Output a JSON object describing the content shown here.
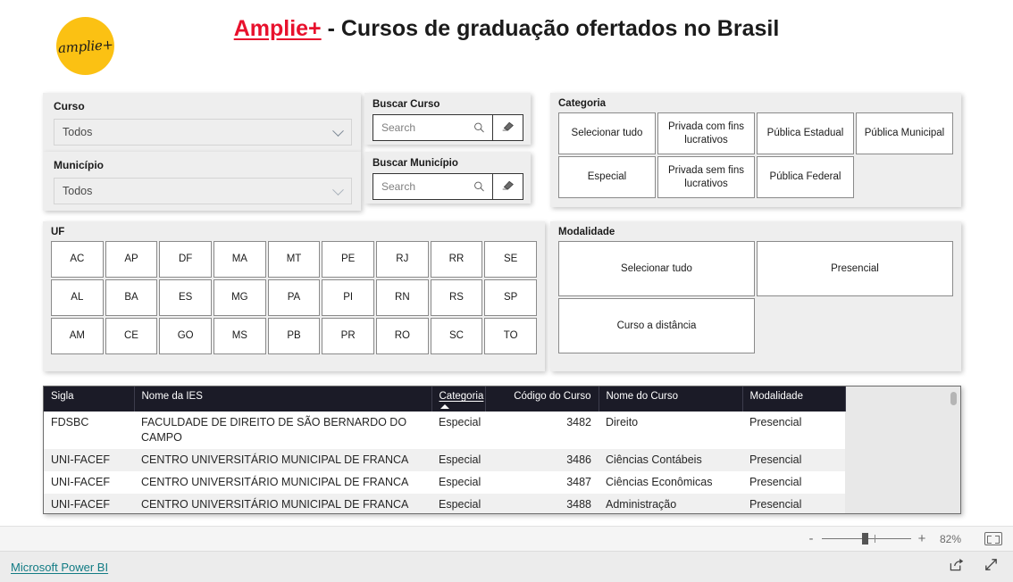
{
  "header": {
    "logo_text": "amplie+",
    "title_brand": "Amplie+",
    "title_rest": " - Cursos de graduação ofertados no Brasil",
    "brand_color": "#e8112d"
  },
  "slicers": {
    "curso": {
      "label": "Curso",
      "value": "Todos"
    },
    "municipio": {
      "label": "Município",
      "value": "Todos"
    },
    "buscar_curso": {
      "label": "Buscar Curso",
      "placeholder": "Search",
      "value": "",
      "search_icon": "search-icon",
      "clear_icon": "eraser-icon"
    },
    "buscar_municipio": {
      "label": "Buscar Município",
      "placeholder": "Search",
      "value": "",
      "search_icon": "search-icon",
      "clear_icon": "eraser-icon"
    },
    "categoria": {
      "title": "Categoria",
      "options": [
        "Selecionar tudo",
        "Privada com fins lucrativos",
        "Pública Estadual",
        "Pública Municipal",
        "Especial",
        "Privada sem fins lucrativos",
        "Pública Federal",
        ""
      ]
    },
    "uf": {
      "title": "UF",
      "options": [
        "AC",
        "AP",
        "DF",
        "MA",
        "MT",
        "PE",
        "RJ",
        "RR",
        "SE",
        "AL",
        "BA",
        "ES",
        "MG",
        "PA",
        "PI",
        "RN",
        "RS",
        "SP",
        "AM",
        "CE",
        "GO",
        "MS",
        "PB",
        "PR",
        "RO",
        "SC",
        "TO"
      ]
    },
    "modalidade": {
      "title": "Modalidade",
      "options": [
        "Selecionar tudo",
        "Presencial",
        "Curso a distância",
        ""
      ]
    }
  },
  "table": {
    "columns": [
      {
        "label": "Sigla",
        "align": "left",
        "sorted": false
      },
      {
        "label": "Nome da IES",
        "align": "left",
        "sorted": false
      },
      {
        "label": "Categoria",
        "align": "left",
        "sorted": true,
        "sort_dir": "asc"
      },
      {
        "label": "Código do Curso",
        "align": "right",
        "sorted": false
      },
      {
        "label": "Nome do Curso",
        "align": "left",
        "sorted": false
      },
      {
        "label": "Modalidade",
        "align": "left",
        "sorted": false
      }
    ],
    "rows": [
      [
        "FDSBC",
        "FACULDADE DE DIREITO DE SÃO BERNARDO DO CAMPO",
        "Especial",
        "3482",
        "Direito",
        "Presencial"
      ],
      [
        "UNI-FACEF",
        "CENTRO UNIVERSITÁRIO MUNICIPAL DE FRANCA",
        "Especial",
        "3486",
        "Ciências Contábeis",
        "Presencial"
      ],
      [
        "UNI-FACEF",
        "CENTRO UNIVERSITÁRIO MUNICIPAL DE FRANCA",
        "Especial",
        "3487",
        "Ciências Econômicas",
        "Presencial"
      ],
      [
        "UNI-FACEF",
        "CENTRO UNIVERSITÁRIO MUNICIPAL DE FRANCA",
        "Especial",
        "3488",
        "Administração",
        "Presencial"
      ]
    ]
  },
  "zoom_bar": {
    "minus_label": "-",
    "plus_label": "+",
    "value": "82%",
    "fit_icon": "fit-to-page-icon"
  },
  "footer": {
    "link_label": "Microsoft Power BI",
    "link_color": "#117b84",
    "share_icon": "share-icon",
    "fullscreen_icon": "fullscreen-icon"
  }
}
